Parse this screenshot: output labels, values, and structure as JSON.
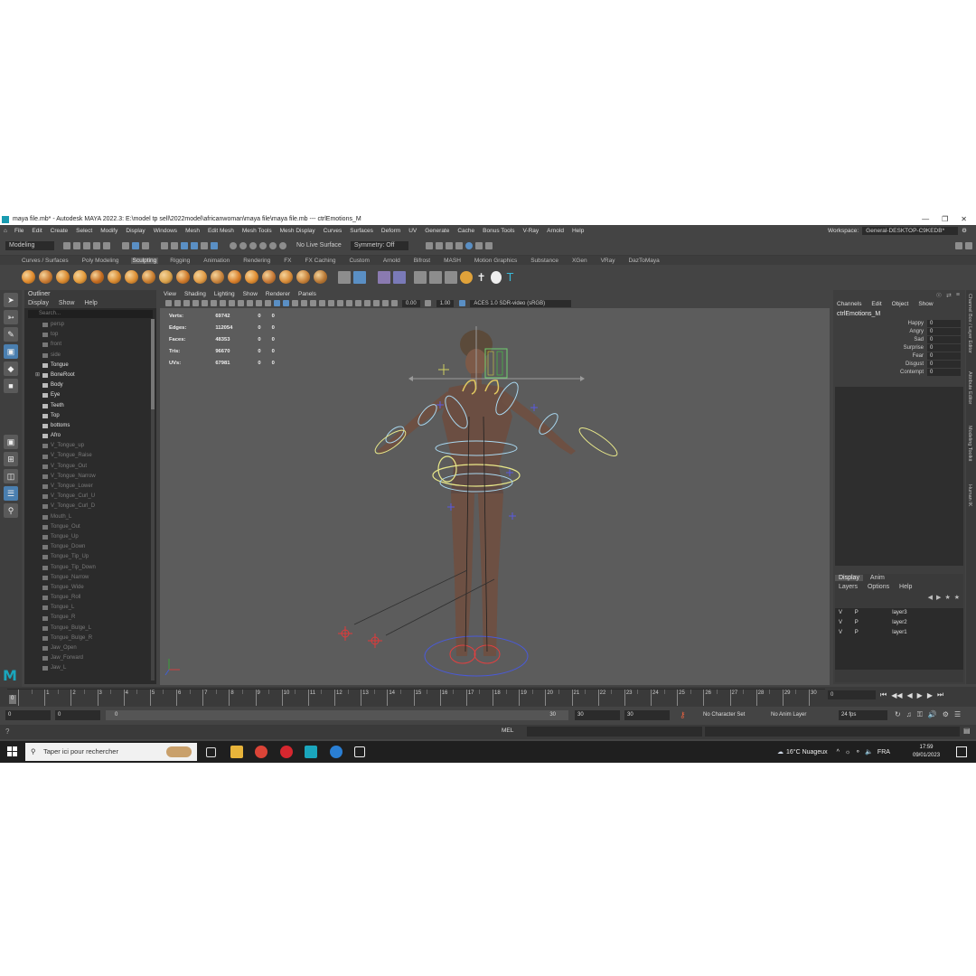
{
  "window": {
    "title": "maya file.mb* - Autodesk MAYA 2022.3: E:\\model tp sell\\2022model\\africanwoman\\maya file\\maya file.mb  ---  ctrlEmotions_M",
    "controls": [
      "—",
      "❐",
      "✕"
    ]
  },
  "menubar": {
    "items": [
      "File",
      "Edit",
      "Create",
      "Select",
      "Modify",
      "Display",
      "Windows",
      "Mesh",
      "Edit Mesh",
      "Mesh Tools",
      "Mesh Display",
      "Curves",
      "Surfaces",
      "Deform",
      "UV",
      "Generate",
      "Cache",
      "Bonus Tools",
      "V-Ray",
      "Arnold",
      "Help"
    ],
    "workspace_label": "Workspace:",
    "workspace_value": "General-DESKTOP-C9KEDB*"
  },
  "statusline": {
    "mode": "Modeling",
    "live_surface": "No Live Surface",
    "symmetry": "Symmetry: Off"
  },
  "shelf": {
    "tabs": [
      "Curves / Surfaces",
      "Poly Modeling",
      "Sculpting",
      "Rigging",
      "Animation",
      "Rendering",
      "FX",
      "FX Caching",
      "Custom",
      "Arnold",
      "Bifrost",
      "MASH",
      "Motion Graphics",
      "Substance",
      "XGen",
      "VRay",
      "DazToMaya"
    ],
    "active_tab": "Sculpting",
    "brush_colors": [
      "#e08a2c",
      "#c97a32",
      "#d9892e",
      "#e39a3a",
      "#c46b1f",
      "#d88a30",
      "#dd8f33",
      "#c87d2f",
      "#d9a24c",
      "#cf7a2a",
      "#e09b45",
      "#c8843d",
      "#d97f2a",
      "#e08d31",
      "#c77936",
      "#d88c39",
      "#c7823a",
      "#b87835"
    ]
  },
  "outliner": {
    "title": "Outliner",
    "menu": [
      "Display",
      "Show",
      "Help"
    ],
    "search_placeholder": "Search...",
    "items": [
      {
        "name": "persp",
        "dim": true
      },
      {
        "name": "top",
        "dim": true
      },
      {
        "name": "front",
        "dim": true
      },
      {
        "name": "side",
        "dim": true
      },
      {
        "name": "Tongue",
        "dim": false
      },
      {
        "name": "BoneRoot",
        "dim": false,
        "expand": true
      },
      {
        "name": "Body",
        "dim": false
      },
      {
        "name": "Eye",
        "dim": false
      },
      {
        "name": "Teeth",
        "dim": false
      },
      {
        "name": "Top",
        "dim": false
      },
      {
        "name": "bottoms",
        "dim": false
      },
      {
        "name": "Afro",
        "dim": false
      },
      {
        "name": "V_Tongue_up",
        "dim": true
      },
      {
        "name": "V_Tongue_Raise",
        "dim": true
      },
      {
        "name": "V_Tongue_Out",
        "dim": true
      },
      {
        "name": "V_Tongue_Narrow",
        "dim": true
      },
      {
        "name": "V_Tongue_Lower",
        "dim": true
      },
      {
        "name": "V_Tongue_Curl_U",
        "dim": true
      },
      {
        "name": "V_Tongue_Curl_D",
        "dim": true
      },
      {
        "name": "Mouth_L",
        "dim": true
      },
      {
        "name": "Tongue_Out",
        "dim": true
      },
      {
        "name": "Tongue_Up",
        "dim": true
      },
      {
        "name": "Tongue_Down",
        "dim": true
      },
      {
        "name": "Tongue_Tip_Up",
        "dim": true
      },
      {
        "name": "Tongue_Tip_Down",
        "dim": true
      },
      {
        "name": "Tongue_Narrow",
        "dim": true
      },
      {
        "name": "Tongue_Wide",
        "dim": true
      },
      {
        "name": "Tongue_Roll",
        "dim": true
      },
      {
        "name": "Tongue_L",
        "dim": true
      },
      {
        "name": "Tongue_R",
        "dim": true
      },
      {
        "name": "Tongue_Bulge_L",
        "dim": true
      },
      {
        "name": "Tongue_Bulge_R",
        "dim": true
      },
      {
        "name": "Jaw_Open",
        "dim": true
      },
      {
        "name": "Jaw_Forward",
        "dim": true
      },
      {
        "name": "Jaw_L",
        "dim": true
      }
    ]
  },
  "viewport": {
    "menu": [
      "View",
      "Shading",
      "Lighting",
      "Show",
      "Renderer",
      "Panels"
    ],
    "exposure": "0.00",
    "gamma": "1.00",
    "colorspace": "ACES 1.0 SDR-video (sRGB)",
    "hud": [
      {
        "label": "Verts:",
        "value": "69742",
        "a": "0",
        "b": "0"
      },
      {
        "label": "Edges:",
        "value": "112054",
        "a": "0",
        "b": "0"
      },
      {
        "label": "Faces:",
        "value": "48353",
        "a": "0",
        "b": "0"
      },
      {
        "label": "Tris:",
        "value": "96670",
        "a": "0",
        "b": "0"
      },
      {
        "label": "UVs:",
        "value": "67981",
        "a": "0",
        "b": "0"
      }
    ]
  },
  "channelbox": {
    "menu": [
      "Channels",
      "Edit",
      "Object",
      "Show"
    ],
    "node": "ctrlEmotions_M",
    "attrs": [
      {
        "name": "Happy",
        "value": "0"
      },
      {
        "name": "Angry",
        "value": "0"
      },
      {
        "name": "Sad",
        "value": "0"
      },
      {
        "name": "Surprise",
        "value": "0"
      },
      {
        "name": "Fear",
        "value": "0"
      },
      {
        "name": "Disgust",
        "value": "0"
      },
      {
        "name": "Contempt",
        "value": "0"
      }
    ]
  },
  "layers": {
    "tabs": [
      "Display",
      "Anim"
    ],
    "menu": [
      "Layers",
      "Options",
      "Help"
    ],
    "rows": [
      {
        "v": "V",
        "p": "P",
        "name": "layer3"
      },
      {
        "v": "V",
        "p": "P",
        "name": "layer2"
      },
      {
        "v": "V",
        "p": "P",
        "name": "layer1"
      }
    ]
  },
  "sidetabs": [
    "Channel Box / Layer Editor",
    "Attribute Editor",
    "Modeling Toolkit",
    "Human IK"
  ],
  "timeline": {
    "ticks": [
      "1",
      "2",
      "3",
      "4",
      "5",
      "6",
      "7",
      "8",
      "9",
      "10",
      "11",
      "12",
      "13",
      "14",
      "15",
      "16",
      "17",
      "18",
      "19",
      "20",
      "21",
      "22",
      "23",
      "24",
      "25",
      "26",
      "27",
      "28",
      "29",
      "30"
    ],
    "current_frame": "0",
    "frame_field": "0"
  },
  "range": {
    "start": "0",
    "start2": "0",
    "slider_start": "0",
    "slider_end": "30",
    "end": "30",
    "end2": "30",
    "character_set": "No Character Set",
    "anim_layer": "No Anim Layer",
    "fps": "24 fps"
  },
  "cmdline": {
    "lang": "MEL"
  },
  "taskbar": {
    "search_placeholder": "Taper ici pour rechercher",
    "weather": "16°C  Nuageux",
    "lang": "FRA",
    "time": "17:59",
    "date": "09/01/2023"
  }
}
